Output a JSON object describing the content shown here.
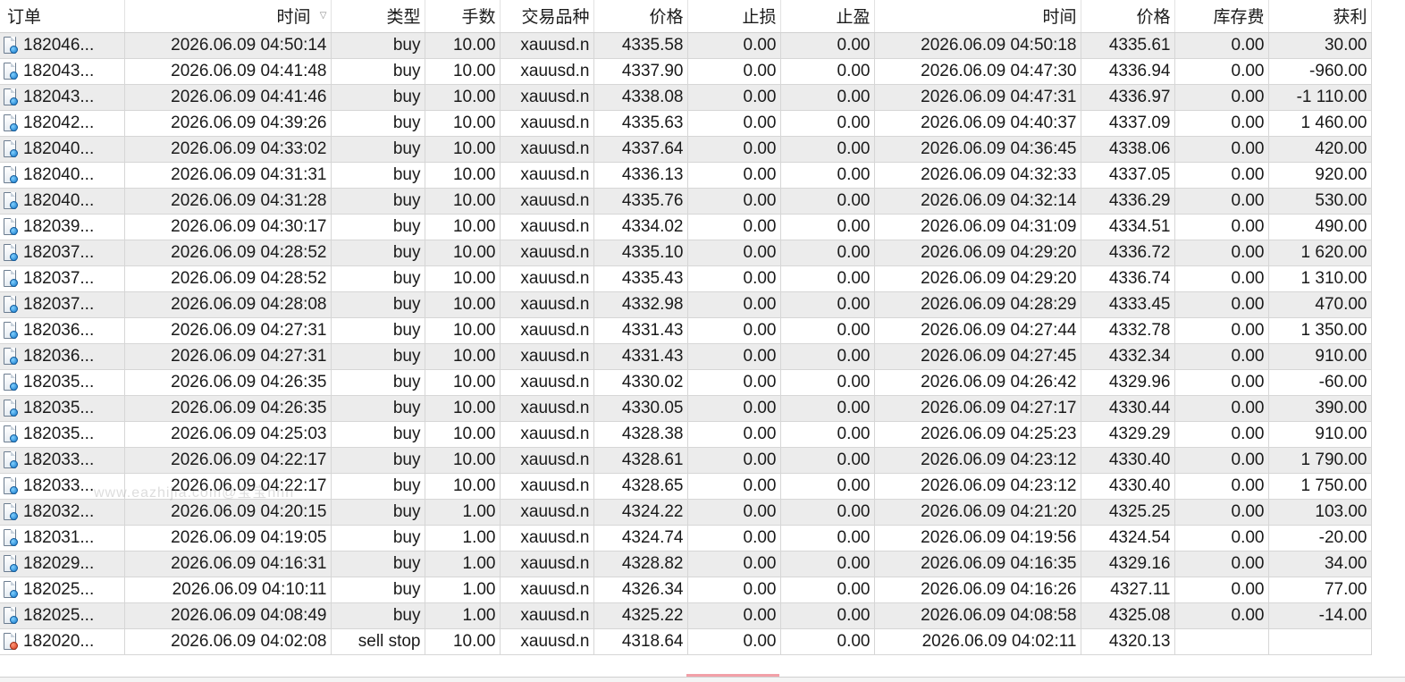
{
  "table": {
    "columns": {
      "order": "订单",
      "open_time": "时间",
      "type": "类型",
      "volume": "手数",
      "symbol": "交易品种",
      "open_price": "价格",
      "sl": "止损",
      "tp": "止盈",
      "close_time": "时间",
      "close_price": "价格",
      "swap": "库存费",
      "profit": "获利"
    },
    "sort_indicator": "▽",
    "rows": [
      {
        "order": "182046...",
        "open_time": "2026.06.09 04:50:14",
        "type": "buy",
        "volume": "10.00",
        "symbol": "xauusd.n",
        "open_price": "4335.58",
        "sl": "0.00",
        "tp": "0.00",
        "close_time": "2026.06.09 04:50:18",
        "close_price": "4335.61",
        "swap": "0.00",
        "profit": "30.00",
        "icon": "blue"
      },
      {
        "order": "182043...",
        "open_time": "2026.06.09 04:41:48",
        "type": "buy",
        "volume": "10.00",
        "symbol": "xauusd.n",
        "open_price": "4337.90",
        "sl": "0.00",
        "tp": "0.00",
        "close_time": "2026.06.09 04:47:30",
        "close_price": "4336.94",
        "swap": "0.00",
        "profit": "-960.00",
        "icon": "blue"
      },
      {
        "order": "182043...",
        "open_time": "2026.06.09 04:41:46",
        "type": "buy",
        "volume": "10.00",
        "symbol": "xauusd.n",
        "open_price": "4338.08",
        "sl": "0.00",
        "tp": "0.00",
        "close_time": "2026.06.09 04:47:31",
        "close_price": "4336.97",
        "swap": "0.00",
        "profit": "-1 110.00",
        "icon": "blue"
      },
      {
        "order": "182042...",
        "open_time": "2026.06.09 04:39:26",
        "type": "buy",
        "volume": "10.00",
        "symbol": "xauusd.n",
        "open_price": "4335.63",
        "sl": "0.00",
        "tp": "0.00",
        "close_time": "2026.06.09 04:40:37",
        "close_price": "4337.09",
        "swap": "0.00",
        "profit": "1 460.00",
        "icon": "blue"
      },
      {
        "order": "182040...",
        "open_time": "2026.06.09 04:33:02",
        "type": "buy",
        "volume": "10.00",
        "symbol": "xauusd.n",
        "open_price": "4337.64",
        "sl": "0.00",
        "tp": "0.00",
        "close_time": "2026.06.09 04:36:45",
        "close_price": "4338.06",
        "swap": "0.00",
        "profit": "420.00",
        "icon": "blue"
      },
      {
        "order": "182040...",
        "open_time": "2026.06.09 04:31:31",
        "type": "buy",
        "volume": "10.00",
        "symbol": "xauusd.n",
        "open_price": "4336.13",
        "sl": "0.00",
        "tp": "0.00",
        "close_time": "2026.06.09 04:32:33",
        "close_price": "4337.05",
        "swap": "0.00",
        "profit": "920.00",
        "icon": "blue"
      },
      {
        "order": "182040...",
        "open_time": "2026.06.09 04:31:28",
        "type": "buy",
        "volume": "10.00",
        "symbol": "xauusd.n",
        "open_price": "4335.76",
        "sl": "0.00",
        "tp": "0.00",
        "close_time": "2026.06.09 04:32:14",
        "close_price": "4336.29",
        "swap": "0.00",
        "profit": "530.00",
        "icon": "blue"
      },
      {
        "order": "182039...",
        "open_time": "2026.06.09 04:30:17",
        "type": "buy",
        "volume": "10.00",
        "symbol": "xauusd.n",
        "open_price": "4334.02",
        "sl": "0.00",
        "tp": "0.00",
        "close_time": "2026.06.09 04:31:09",
        "close_price": "4334.51",
        "swap": "0.00",
        "profit": "490.00",
        "icon": "blue"
      },
      {
        "order": "182037...",
        "open_time": "2026.06.09 04:28:52",
        "type": "buy",
        "volume": "10.00",
        "symbol": "xauusd.n",
        "open_price": "4335.10",
        "sl": "0.00",
        "tp": "0.00",
        "close_time": "2026.06.09 04:29:20",
        "close_price": "4336.72",
        "swap": "0.00",
        "profit": "1 620.00",
        "icon": "blue"
      },
      {
        "order": "182037...",
        "open_time": "2026.06.09 04:28:52",
        "type": "buy",
        "volume": "10.00",
        "symbol": "xauusd.n",
        "open_price": "4335.43",
        "sl": "0.00",
        "tp": "0.00",
        "close_time": "2026.06.09 04:29:20",
        "close_price": "4336.74",
        "swap": "0.00",
        "profit": "1 310.00",
        "icon": "blue"
      },
      {
        "order": "182037...",
        "open_time": "2026.06.09 04:28:08",
        "type": "buy",
        "volume": "10.00",
        "symbol": "xauusd.n",
        "open_price": "4332.98",
        "sl": "0.00",
        "tp": "0.00",
        "close_time": "2026.06.09 04:28:29",
        "close_price": "4333.45",
        "swap": "0.00",
        "profit": "470.00",
        "icon": "blue"
      },
      {
        "order": "182036...",
        "open_time": "2026.06.09 04:27:31",
        "type": "buy",
        "volume": "10.00",
        "symbol": "xauusd.n",
        "open_price": "4331.43",
        "sl": "0.00",
        "tp": "0.00",
        "close_time": "2026.06.09 04:27:44",
        "close_price": "4332.78",
        "swap": "0.00",
        "profit": "1 350.00",
        "icon": "blue"
      },
      {
        "order": "182036...",
        "open_time": "2026.06.09 04:27:31",
        "type": "buy",
        "volume": "10.00",
        "symbol": "xauusd.n",
        "open_price": "4331.43",
        "sl": "0.00",
        "tp": "0.00",
        "close_time": "2026.06.09 04:27:45",
        "close_price": "4332.34",
        "swap": "0.00",
        "profit": "910.00",
        "icon": "blue"
      },
      {
        "order": "182035...",
        "open_time": "2026.06.09 04:26:35",
        "type": "buy",
        "volume": "10.00",
        "symbol": "xauusd.n",
        "open_price": "4330.02",
        "sl": "0.00",
        "tp": "0.00",
        "close_time": "2026.06.09 04:26:42",
        "close_price": "4329.96",
        "swap": "0.00",
        "profit": "-60.00",
        "icon": "blue"
      },
      {
        "order": "182035...",
        "open_time": "2026.06.09 04:26:35",
        "type": "buy",
        "volume": "10.00",
        "symbol": "xauusd.n",
        "open_price": "4330.05",
        "sl": "0.00",
        "tp": "0.00",
        "close_time": "2026.06.09 04:27:17",
        "close_price": "4330.44",
        "swap": "0.00",
        "profit": "390.00",
        "icon": "blue"
      },
      {
        "order": "182035...",
        "open_time": "2026.06.09 04:25:03",
        "type": "buy",
        "volume": "10.00",
        "symbol": "xauusd.n",
        "open_price": "4328.38",
        "sl": "0.00",
        "tp": "0.00",
        "close_time": "2026.06.09 04:25:23",
        "close_price": "4329.29",
        "swap": "0.00",
        "profit": "910.00",
        "icon": "blue"
      },
      {
        "order": "182033...",
        "open_time": "2026.06.09 04:22:17",
        "type": "buy",
        "volume": "10.00",
        "symbol": "xauusd.n",
        "open_price": "4328.61",
        "sl": "0.00",
        "tp": "0.00",
        "close_time": "2026.06.09 04:23:12",
        "close_price": "4330.40",
        "swap": "0.00",
        "profit": "1 790.00",
        "icon": "blue"
      },
      {
        "order": "182033...",
        "open_time": "2026.06.09 04:22:17",
        "type": "buy",
        "volume": "10.00",
        "symbol": "xauusd.n",
        "open_price": "4328.65",
        "sl": "0.00",
        "tp": "0.00",
        "close_time": "2026.06.09 04:23:12",
        "close_price": "4330.40",
        "swap": "0.00",
        "profit": "1 750.00",
        "icon": "blue"
      },
      {
        "order": "182032...",
        "open_time": "2026.06.09 04:20:15",
        "type": "buy",
        "volume": "1.00",
        "symbol": "xauusd.n",
        "open_price": "4324.22",
        "sl": "0.00",
        "tp": "0.00",
        "close_time": "2026.06.09 04:21:20",
        "close_price": "4325.25",
        "swap": "0.00",
        "profit": "103.00",
        "icon": "blue"
      },
      {
        "order": "182031...",
        "open_time": "2026.06.09 04:19:05",
        "type": "buy",
        "volume": "1.00",
        "symbol": "xauusd.n",
        "open_price": "4324.74",
        "sl": "0.00",
        "tp": "0.00",
        "close_time": "2026.06.09 04:19:56",
        "close_price": "4324.54",
        "swap": "0.00",
        "profit": "-20.00",
        "icon": "blue"
      },
      {
        "order": "182029...",
        "open_time": "2026.06.09 04:16:31",
        "type": "buy",
        "volume": "1.00",
        "symbol": "xauusd.n",
        "open_price": "4328.82",
        "sl": "0.00",
        "tp": "0.00",
        "close_time": "2026.06.09 04:16:35",
        "close_price": "4329.16",
        "swap": "0.00",
        "profit": "34.00",
        "icon": "blue"
      },
      {
        "order": "182025...",
        "open_time": "2026.06.09 04:10:11",
        "type": "buy",
        "volume": "1.00",
        "symbol": "xauusd.n",
        "open_price": "4326.34",
        "sl": "0.00",
        "tp": "0.00",
        "close_time": "2026.06.09 04:16:26",
        "close_price": "4327.11",
        "swap": "0.00",
        "profit": "77.00",
        "icon": "blue"
      },
      {
        "order": "182025...",
        "open_time": "2026.06.09 04:08:49",
        "type": "buy",
        "volume": "1.00",
        "symbol": "xauusd.n",
        "open_price": "4325.22",
        "sl": "0.00",
        "tp": "0.00",
        "close_time": "2026.06.09 04:08:58",
        "close_price": "4325.08",
        "swap": "0.00",
        "profit": "-14.00",
        "icon": "blue"
      },
      {
        "order": "182020...",
        "open_time": "2026.06.09 04:02:08",
        "type": "sell stop",
        "volume": "10.00",
        "symbol": "xauusd.n",
        "open_price": "4318.64",
        "sl": "0.00",
        "tp": "0.00",
        "close_time": "2026.06.09 04:02:11",
        "close_price": "4320.13",
        "swap": "",
        "profit": "",
        "icon": "red"
      }
    ]
  },
  "watermark": "www.eazhijia.com@宝宝nnn",
  "colors": {
    "row_alt": "#ececec",
    "row_base": "#ffffff",
    "grid_line": "#d6d6d6",
    "order_dot_filled": "#1677c8",
    "order_dot_pending": "#d2341a",
    "sl_marker": "#f2a0a8"
  }
}
